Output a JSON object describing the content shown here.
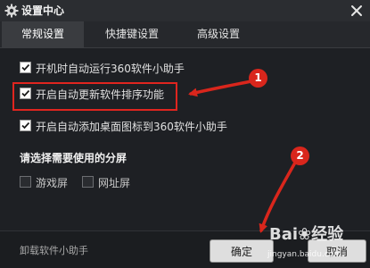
{
  "window": {
    "title": "设置中心",
    "close_icon": "close-icon",
    "settings_icon": "gear-icon"
  },
  "tabs": [
    {
      "label": "常规设置",
      "active": true
    },
    {
      "label": "快捷键设置",
      "active": false
    },
    {
      "label": "高级设置",
      "active": false
    }
  ],
  "options": [
    {
      "label": "开机时自动运行360软件小助手",
      "checked": true
    },
    {
      "label": "开启自动更新软件排序功能",
      "checked": true
    },
    {
      "label": "开启自动添加桌面图标到360软件小助手",
      "checked": true
    }
  ],
  "split_screen": {
    "title": "请选择需要使用的分屏",
    "items": [
      {
        "label": "游戏屏",
        "checked": false
      },
      {
        "label": "网址屏",
        "checked": false
      }
    ]
  },
  "footer": {
    "uninstall_label": "卸载软件小助手",
    "ok_label": "确定",
    "cancel_label": "取消"
  },
  "annotations": {
    "step1": "1",
    "step2": "2",
    "color": "#d9261c"
  },
  "watermark": {
    "main": "Bai❀经验",
    "url": "jingyan.baidu.com"
  }
}
